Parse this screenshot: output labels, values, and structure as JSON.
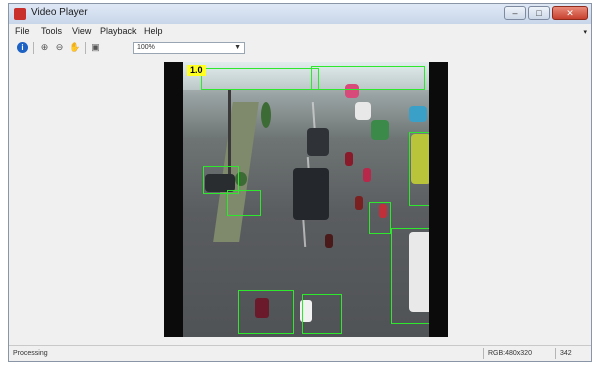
{
  "window": {
    "title": "Video Player"
  },
  "menu": [
    "File",
    "Tools",
    "View",
    "Playback",
    "Help"
  ],
  "toolbar": {
    "zoom_value": "100%"
  },
  "video": {
    "frame_number": "1.0",
    "detection_color": "#2ee82e"
  },
  "status": {
    "text": "Processing",
    "format": "RGB:480x320",
    "frame_count": "342"
  }
}
